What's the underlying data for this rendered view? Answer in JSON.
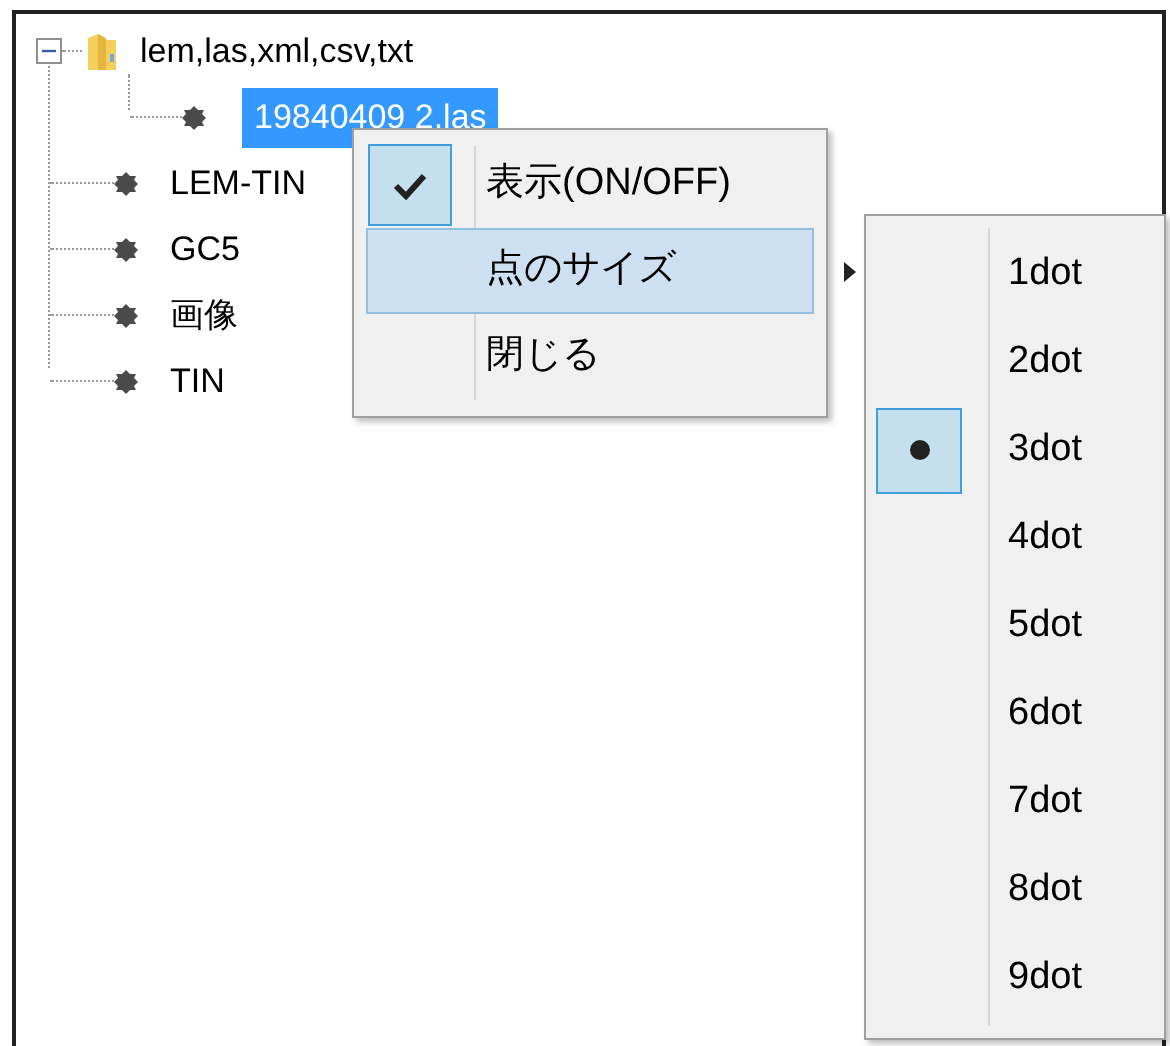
{
  "tree": {
    "items": [
      {
        "label": "lem,las,xml,csv,txt",
        "kind": "folder",
        "expanded": true,
        "selected": false,
        "children": [
          {
            "label": "19840409 2.las",
            "kind": "layer",
            "selected": true
          }
        ]
      },
      {
        "label": "LEM-TIN",
        "kind": "layer",
        "selected": false
      },
      {
        "label": "GC5",
        "kind": "layer",
        "selected": false
      },
      {
        "label": "画像",
        "kind": "layer",
        "selected": false
      },
      {
        "label": "TIN",
        "kind": "layer",
        "selected": false
      }
    ]
  },
  "context_menu": {
    "items": [
      {
        "label": "表示(ON/OFF)",
        "kind": "check",
        "checked": true,
        "selected": false
      },
      {
        "label": "点のサイズ",
        "kind": "submenu",
        "selected": true
      },
      {
        "label": "閉じる",
        "kind": "command",
        "selected": false
      }
    ]
  },
  "size_submenu": {
    "items": [
      {
        "label": "1dot",
        "selected": false
      },
      {
        "label": "2dot",
        "selected": false
      },
      {
        "label": "3dot",
        "selected": true
      },
      {
        "label": "4dot",
        "selected": false
      },
      {
        "label": "5dot",
        "selected": false
      },
      {
        "label": "6dot",
        "selected": false
      },
      {
        "label": "7dot",
        "selected": false
      },
      {
        "label": "8dot",
        "selected": false
      },
      {
        "label": "9dot",
        "selected": false
      }
    ]
  }
}
